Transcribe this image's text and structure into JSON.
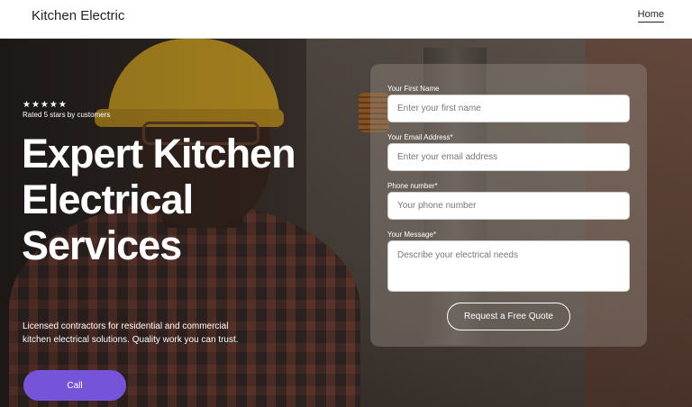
{
  "header": {
    "brand": "Kitchen Electric",
    "nav_home": "Home"
  },
  "hero": {
    "stars": "★★★★★",
    "rating_text": "Rated 5 stars by customers",
    "title": "Expert Kitchen Electrical Services",
    "description": "Licensed contractors for residential and commercial kitchen electrical solutions. Quality work you can trust.",
    "call_label": "Call"
  },
  "form": {
    "first_name_label": "Your First Name",
    "first_name_placeholder": "Enter your first name",
    "email_label": "Your Email Address*",
    "email_placeholder": "Enter your email address",
    "phone_label": "Phone number*",
    "phone_placeholder": "Your phone number",
    "message_label": "Your Message*",
    "message_placeholder": "Describe your electrical needs",
    "submit_label": "Request a Free Quote"
  },
  "colors": {
    "accent": "#7654d9",
    "header_bg": "#ffffff"
  }
}
